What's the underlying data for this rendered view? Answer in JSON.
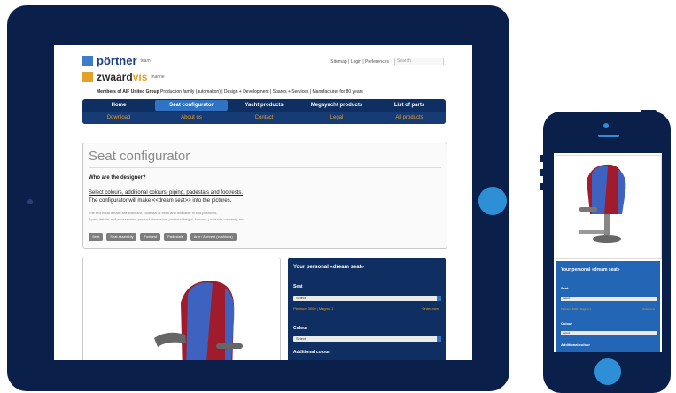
{
  "tablet_site": {
    "logo_primary": "pörtner",
    "logo_primary_sub": "team",
    "logo_secondary": "zwaard",
    "logo_secondary_accent": "vis",
    "logo_secondary_sub": "marine",
    "top_links": "Sitemap | Login | Preferences",
    "search_placeholder": "Search",
    "members_bold": "Members of AIF United Group",
    "members_rest": "Production family (automation) | Design + Development | Spares + Services | Manufacturer for 80 years",
    "nav_main": [
      "Home",
      "Seat configurator",
      "Yacht products",
      "Megayacht products",
      "List of parts"
    ],
    "nav_sub": [
      "Download",
      "About us",
      "Contact",
      "Legal",
      "All products"
    ],
    "title": "Seat configurator",
    "question": "Who are the designer?",
    "intro_line1": "Select colours, additional colours, piping, padestals and footrests.",
    "intro_line2": "The configurator will make <<dream seat>> into the pictures.",
    "note_line1": "The technical details are standard, padestal is fixed and available in two positions.",
    "note_line2": "Spare details and accessories, product dimension, padestal height, footrest, product's warranty, etc.",
    "buttons": [
      "Seat",
      "Seat assembly",
      "Footrest",
      "Padestals",
      "Arm / Armrest (cushions)"
    ],
    "panel_title": "Your personal «dream seat»",
    "seat_label": "Seat",
    "seat_value": "Select",
    "seat_info": "Platinum 3000 | Magma 1",
    "seat_extra": "Order now",
    "colour_label": "Colour",
    "colour_value": "Select",
    "additional_label": "Additional colour"
  },
  "phone_site": {
    "panel_title": "Your personal «dream seat»",
    "seat_label": "Seat",
    "seat_value": "Select",
    "seat_info": "Platinum 3000 | Magma 1",
    "seat_extra": "Order now",
    "colour_label": "Colour",
    "colour_value": "Select",
    "additional_label": "Additional colour"
  },
  "colors": {
    "device": "#0b1f4b",
    "accent_blue": "#2e8fd6",
    "nav_blue": "#0f2f63",
    "accent_orange": "#e3a12a",
    "seat_red": "#a01c2c",
    "seat_blue": "#3d62c0"
  },
  "icons": [
    "logo-box",
    "home-button",
    "seat-illustration"
  ]
}
